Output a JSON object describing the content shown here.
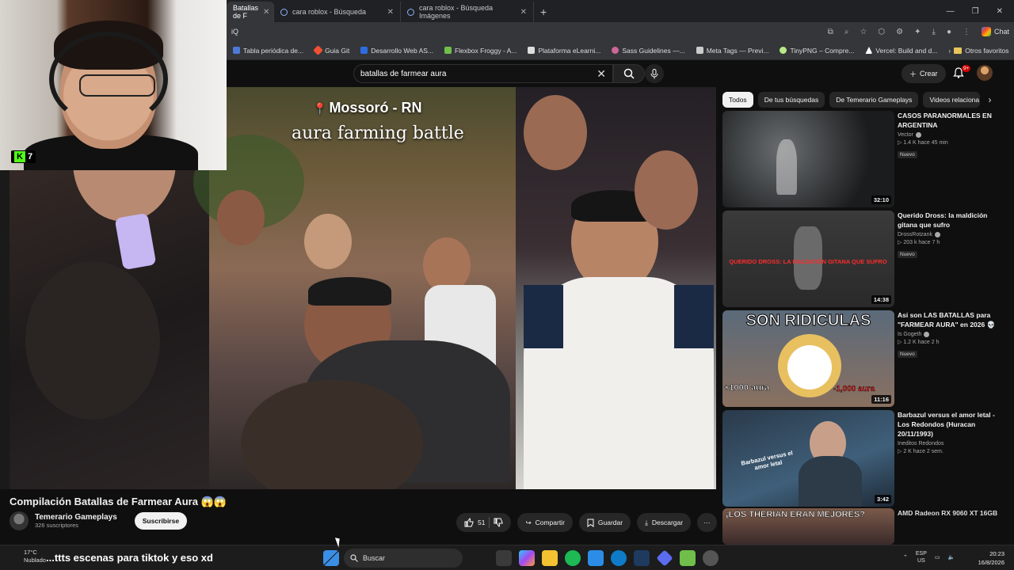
{
  "browser": {
    "tabs": [
      {
        "label": "Batallas de F"
      },
      {
        "label": "cara roblox - Búsqueda"
      },
      {
        "label": "cara roblox - Búsqueda Imágenes"
      }
    ],
    "new_tab": "+",
    "address_fragment": "iQ",
    "chat_label": "Chat",
    "bookmarks": [
      {
        "label": "Tabla periódica de..."
      },
      {
        "label": "Guia Git"
      },
      {
        "label": "Desarrollo Web AS..."
      },
      {
        "label": "Flexbox Froggy - A..."
      },
      {
        "label": "Plataforma eLearni..."
      },
      {
        "label": "Sass Guidelines —..."
      },
      {
        "label": "Meta Tags — Previ..."
      },
      {
        "label": "TinyPNG – Compre..."
      },
      {
        "label": "Vercel: Build and d..."
      }
    ],
    "other_bookmarks": "Otros favoritos"
  },
  "youtube": {
    "search_value": "batallas de farmear aura",
    "create_label": "Crear",
    "notif_badge": "9+"
  },
  "webcam": {
    "kick_count": "7"
  },
  "video": {
    "caption_location": "Mossoró - RN",
    "caption_main": "aura farming battle",
    "title": "Compilación Batallas de Farmear Aura 😱😱",
    "channel_name": "Temerario Gameplays",
    "subscribers": "326 suscriptores",
    "subscribe_label": "Suscribirse",
    "likes": "51",
    "share_label": "Compartir",
    "save_label": "Guardar",
    "download_label": "Descargar",
    "more_label": "···"
  },
  "sidebar": {
    "chips": [
      {
        "label": "Todos"
      },
      {
        "label": "De tus búsquedas"
      },
      {
        "label": "De Temerario Gameplays"
      },
      {
        "label": "Videos relaciona"
      }
    ],
    "videos": [
      {
        "title": "CASOS PARANORMALES EN ARGENTINA",
        "channel": "Vector",
        "meta": "▷ 1.4 K  hace 45 min",
        "badge": "Nuevo",
        "duration": "32:10"
      },
      {
        "title": "Querido Dross: la maldición gitana que sufro",
        "channel": "DrossRotzank",
        "meta": "▷ 203 k  hace 7 h",
        "badge": "Nuevo",
        "duration": "14:38",
        "thumb_text": "QUERIDO DROSS: LA MALDICIÓN GITANA QUE SUFRO"
      },
      {
        "title": "Asi son LAS BATALLAS para \"FARMEAR AURA\" en 2026 💀",
        "channel": "Is Gogeth",
        "meta": "▷ 1.2 K  hace 2 h",
        "badge": "Nuevo",
        "duration": "11:16",
        "thumb_text": "SON RIDICULAS",
        "thumb_left": "+1000 aura",
        "thumb_right": "-1,000 aura"
      },
      {
        "title": "Barbazul versus el amor letal - Los Redondos (Huracan 20/11/1993)",
        "channel": "Ineditos Redondos",
        "meta": "▷ 2 K  hace 2 sem.",
        "badge": "",
        "duration": "3:42",
        "thumb_text": "Barbazul versus el amor letal"
      },
      {
        "title": "AMD Radeon RX 9060 XT 16GB",
        "channel": "",
        "meta": "",
        "badge": "",
        "duration": "",
        "thumb_text": "¡LOS THERIAN ERAN MEJORES?"
      }
    ]
  },
  "taskbar": {
    "temperature": "17°C",
    "weather": "Nublado",
    "caption": "...ttts escenas para tiktok y eso xd",
    "search_label": "Buscar",
    "lang_top": "ESP",
    "lang_bottom": "US",
    "time": "20:23",
    "date": "16/8/2026"
  }
}
